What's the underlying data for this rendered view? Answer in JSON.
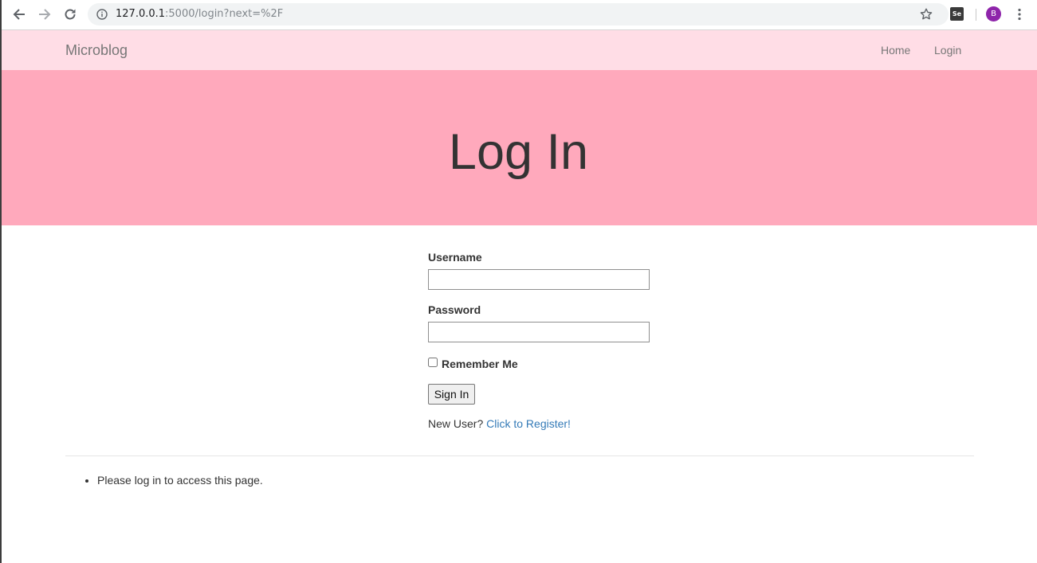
{
  "browser": {
    "url_host": "127.0.0.1",
    "url_path": ":5000/login?next=%2F",
    "extension_label": "Se",
    "profile_initial": "B"
  },
  "nav": {
    "brand": "Microblog",
    "links": [
      "Home",
      "Login"
    ]
  },
  "hero": {
    "title": "Log In"
  },
  "form": {
    "username_label": "Username",
    "username_value": "",
    "password_label": "Password",
    "password_value": "",
    "remember_label": "Remember Me",
    "remember_checked": false,
    "submit_label": "Sign In",
    "new_user_text": "New User? ",
    "register_link": "Click to Register!"
  },
  "messages": [
    "Please log in to access this page."
  ]
}
